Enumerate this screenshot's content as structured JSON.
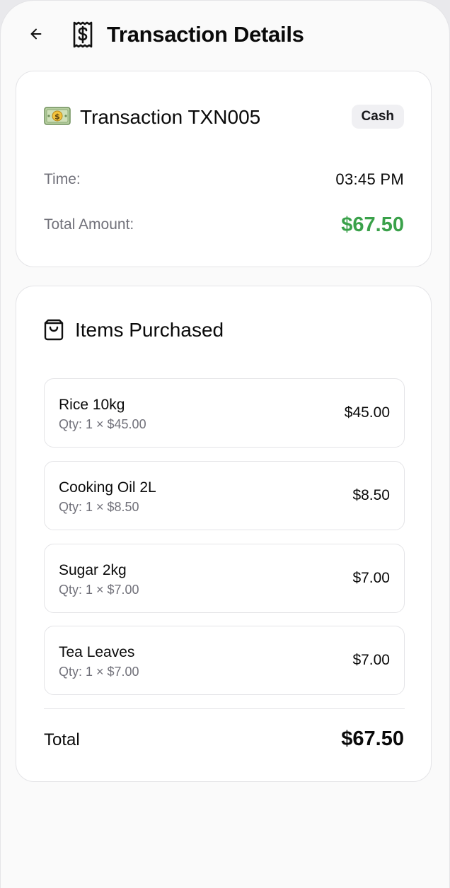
{
  "header": {
    "title": "Transaction Details",
    "back_icon": "arrow-left-icon",
    "title_icon": "receipt-dollar-icon"
  },
  "summary": {
    "emoji": "money-banknote-icon",
    "title": "Transaction TXN005",
    "payment_badge": "Cash",
    "time_label": "Time:",
    "time_value": "03:45 PM",
    "amount_label": "Total Amount:",
    "amount_value": "$67.50",
    "amount_color": "#3aa14a"
  },
  "items_section": {
    "icon": "shopping-bag-icon",
    "title": "Items Purchased",
    "items": [
      {
        "name": "Rice 10kg",
        "qty": "Qty: 1 × $45.00",
        "price": "$45.00"
      },
      {
        "name": "Cooking Oil 2L",
        "qty": "Qty: 1 × $8.50",
        "price": "$8.50"
      },
      {
        "name": "Sugar 2kg",
        "qty": "Qty: 1 × $7.00",
        "price": "$7.00"
      },
      {
        "name": "Tea Leaves",
        "qty": "Qty: 1 × $7.00",
        "price": "$7.00"
      }
    ],
    "total_label": "Total",
    "total_value": "$67.50"
  }
}
